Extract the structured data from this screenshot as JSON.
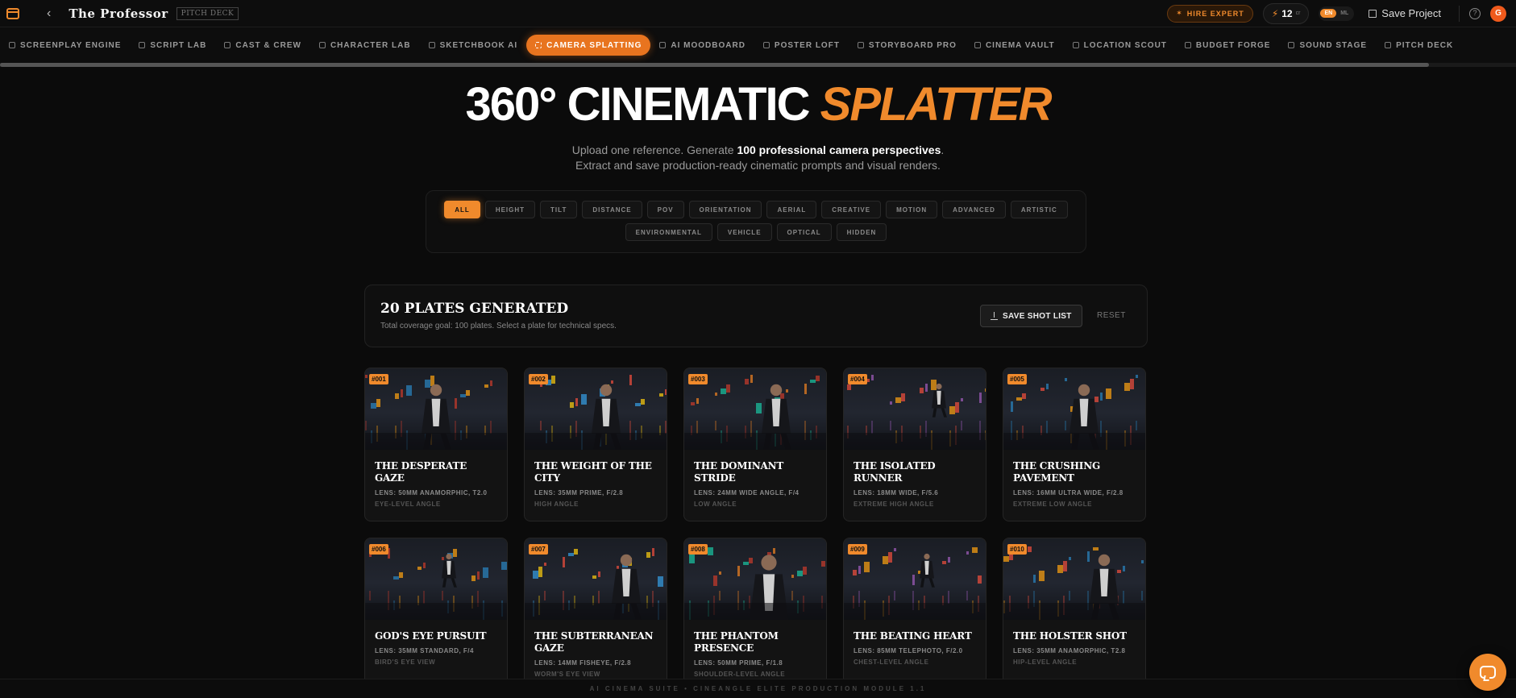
{
  "topbar": {
    "project_title": "The Professor",
    "project_badge": "PITCH DECK",
    "hire_label": "HIRE EXPERT",
    "credits": "12",
    "credits_unit": "cr",
    "lang_on": "EN",
    "lang_off": "ML",
    "save_label": "Save Project",
    "help_glyph": "?",
    "avatar_initial": "G"
  },
  "nav": [
    {
      "label": "SCREENPLAY ENGINE",
      "icon": "screenplay-icon",
      "active": false
    },
    {
      "label": "SCRIPT LAB",
      "icon": "script-icon",
      "active": false
    },
    {
      "label": "CAST & CREW",
      "icon": "cast-icon",
      "active": false
    },
    {
      "label": "CHARACTER LAB",
      "icon": "character-icon",
      "active": false
    },
    {
      "label": "SKETCHBOOK AI",
      "icon": "sketch-icon",
      "active": false
    },
    {
      "label": "CAMERA SPLATTING",
      "icon": "camera-icon",
      "active": true
    },
    {
      "label": "AI MOODBOARD",
      "icon": "moodboard-icon",
      "active": false
    },
    {
      "label": "POSTER LOFT",
      "icon": "poster-icon",
      "active": false
    },
    {
      "label": "STORYBOARD PRO",
      "icon": "storyboard-icon",
      "active": false
    },
    {
      "label": "CINEMA VAULT",
      "icon": "vault-icon",
      "active": false
    },
    {
      "label": "LOCATION SCOUT",
      "icon": "location-icon",
      "active": false
    },
    {
      "label": "BUDGET FORGE",
      "icon": "budget-icon",
      "active": false
    },
    {
      "label": "SOUND STAGE",
      "icon": "sound-icon",
      "active": false
    },
    {
      "label": "PITCH DECK",
      "icon": "pitch-icon",
      "active": false
    }
  ],
  "hero": {
    "title_main": "360° CINEMATIC",
    "title_accent": "SPLATTER",
    "sub1_pre": "Upload one reference. Generate",
    "sub1_bold": "100 professional camera perspectives",
    "sub1_post": ".",
    "sub2": "Extract and save production-ready cinematic prompts and visual renders."
  },
  "filters": {
    "row1": [
      "ALL",
      "HEIGHT",
      "TILT",
      "DISTANCE",
      "POV",
      "ORIENTATION",
      "AERIAL",
      "CREATIVE",
      "MOTION",
      "ADVANCED",
      "ARTISTIC"
    ],
    "row2": [
      "ENVIRONMENTAL",
      "VEHICLE",
      "OPTICAL",
      "HIDDEN"
    ],
    "active": "ALL"
  },
  "plates": {
    "title": "20 PLATES GENERATED",
    "subtitle": "Total coverage goal: 100 plates. Select a plate for technical specs.",
    "save_label": "SAVE SHOT LIST",
    "reset_label": "RESET"
  },
  "cards": [
    {
      "num": "#001",
      "title": "THE DESPERATE GAZE",
      "lens": "LENS: 50MM ANAMORPHIC, T2.0",
      "angle": "EYE-LEVEL ANGLE"
    },
    {
      "num": "#002",
      "title": "THE WEIGHT OF THE CITY",
      "lens": "LENS: 35MM PRIME, F/2.8",
      "angle": "HIGH ANGLE"
    },
    {
      "num": "#003",
      "title": "THE DOMINANT STRIDE",
      "lens": "LENS: 24MM WIDE ANGLE, F/4",
      "angle": "LOW ANGLE"
    },
    {
      "num": "#004",
      "title": "THE ISOLATED RUNNER",
      "lens": "LENS: 18MM WIDE, F/5.6",
      "angle": "EXTREME HIGH ANGLE"
    },
    {
      "num": "#005",
      "title": "THE CRUSHING PAVEMENT",
      "lens": "LENS: 16MM ULTRA WIDE, F/2.8",
      "angle": "EXTREME LOW ANGLE"
    },
    {
      "num": "#006",
      "title": "GOD'S EYE PURSUIT",
      "lens": "LENS: 35MM STANDARD, F/4",
      "angle": "BIRD'S EYE VIEW"
    },
    {
      "num": "#007",
      "title": "THE SUBTERRANEAN GAZE",
      "lens": "LENS: 14MM FISHEYE, F/2.8",
      "angle": "WORM'S EYE VIEW"
    },
    {
      "num": "#008",
      "title": "THE PHANTOM PRESENCE",
      "lens": "LENS: 50MM PRIME, F/1.8",
      "angle": "SHOULDER-LEVEL ANGLE"
    },
    {
      "num": "#009",
      "title": "THE BEATING HEART",
      "lens": "LENS: 85MM TELEPHOTO, F/2.0",
      "angle": "CHEST-LEVEL ANGLE"
    },
    {
      "num": "#010",
      "title": "THE HOLSTER SHOT",
      "lens": "LENS: 35MM ANAMORPHIC, T2.8",
      "angle": "HIP-LEVEL ANGLE"
    }
  ],
  "footer": "AI CINEMA SUITE • CINEANGLE ELITE PRODUCTION MODULE 1.1",
  "colors": {
    "accent": "#f08a2c",
    "background": "#0b0b0b"
  }
}
